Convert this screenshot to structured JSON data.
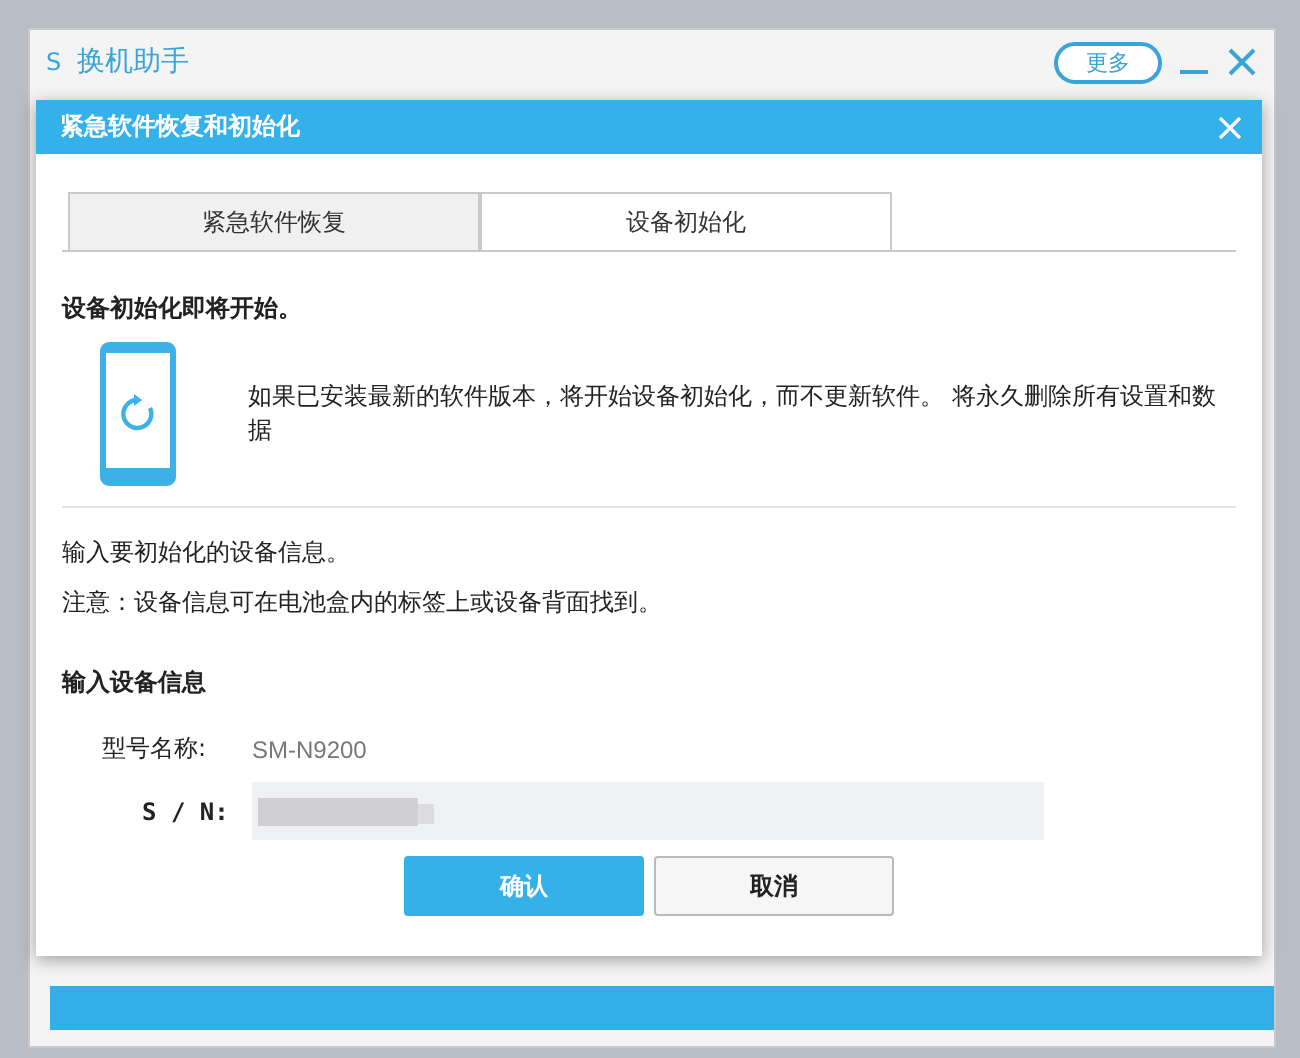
{
  "app_window": {
    "logo": "S",
    "title": "换机助手",
    "more_button": "更多"
  },
  "dialog": {
    "title": "紧急软件恢复和初始化",
    "tabs": [
      {
        "label": "紧急软件恢复",
        "selected": false
      },
      {
        "label": "设备初始化",
        "selected": true
      }
    ],
    "heading": "设备初始化即将开始。",
    "description": "如果已安装最新的软件版本，将开始设备初始化，而不更新软件。 将永久删除所有设置和数据",
    "instructions": [
      "输入要初始化的设备信息。",
      "注意：设备信息可在电池盒内的标签上或设备背面找到。"
    ],
    "section_title": "输入设备信息",
    "fields": [
      {
        "kind": "text",
        "label": "型号名称:",
        "value": "SM-N9200"
      },
      {
        "kind": "blurred",
        "label": "S / N:"
      }
    ],
    "buttons": [
      {
        "label": "确认",
        "kind": "primary"
      },
      {
        "label": "取消",
        "kind": "secondary"
      }
    ]
  }
}
